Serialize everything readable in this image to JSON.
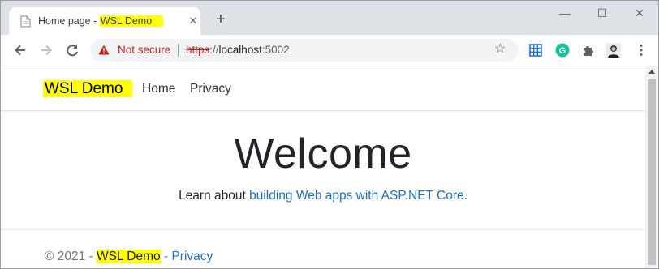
{
  "browser": {
    "tab": {
      "title_prefix": "Home page - ",
      "title_highlight": "WSL Demo",
      "close": "✕"
    },
    "new_tab": "+",
    "window_controls": {
      "minimize": "—",
      "maximize": "☐",
      "close": "✕"
    },
    "address": {
      "security_label": "Not secure",
      "scheme": "https",
      "rest": "://",
      "host": "localhost",
      "port": ":5002"
    }
  },
  "site": {
    "brand": "WSL Demo",
    "nav": [
      "Home",
      "Privacy"
    ],
    "heading": "Welcome",
    "lead_text": "Learn about ",
    "lead_link": "building Web apps with ASP.NET Core",
    "lead_end": ".",
    "footer": {
      "prefix": "© 2021 - ",
      "brand": "WSL Demo",
      "dash": " - ",
      "link": "Privacy"
    }
  }
}
